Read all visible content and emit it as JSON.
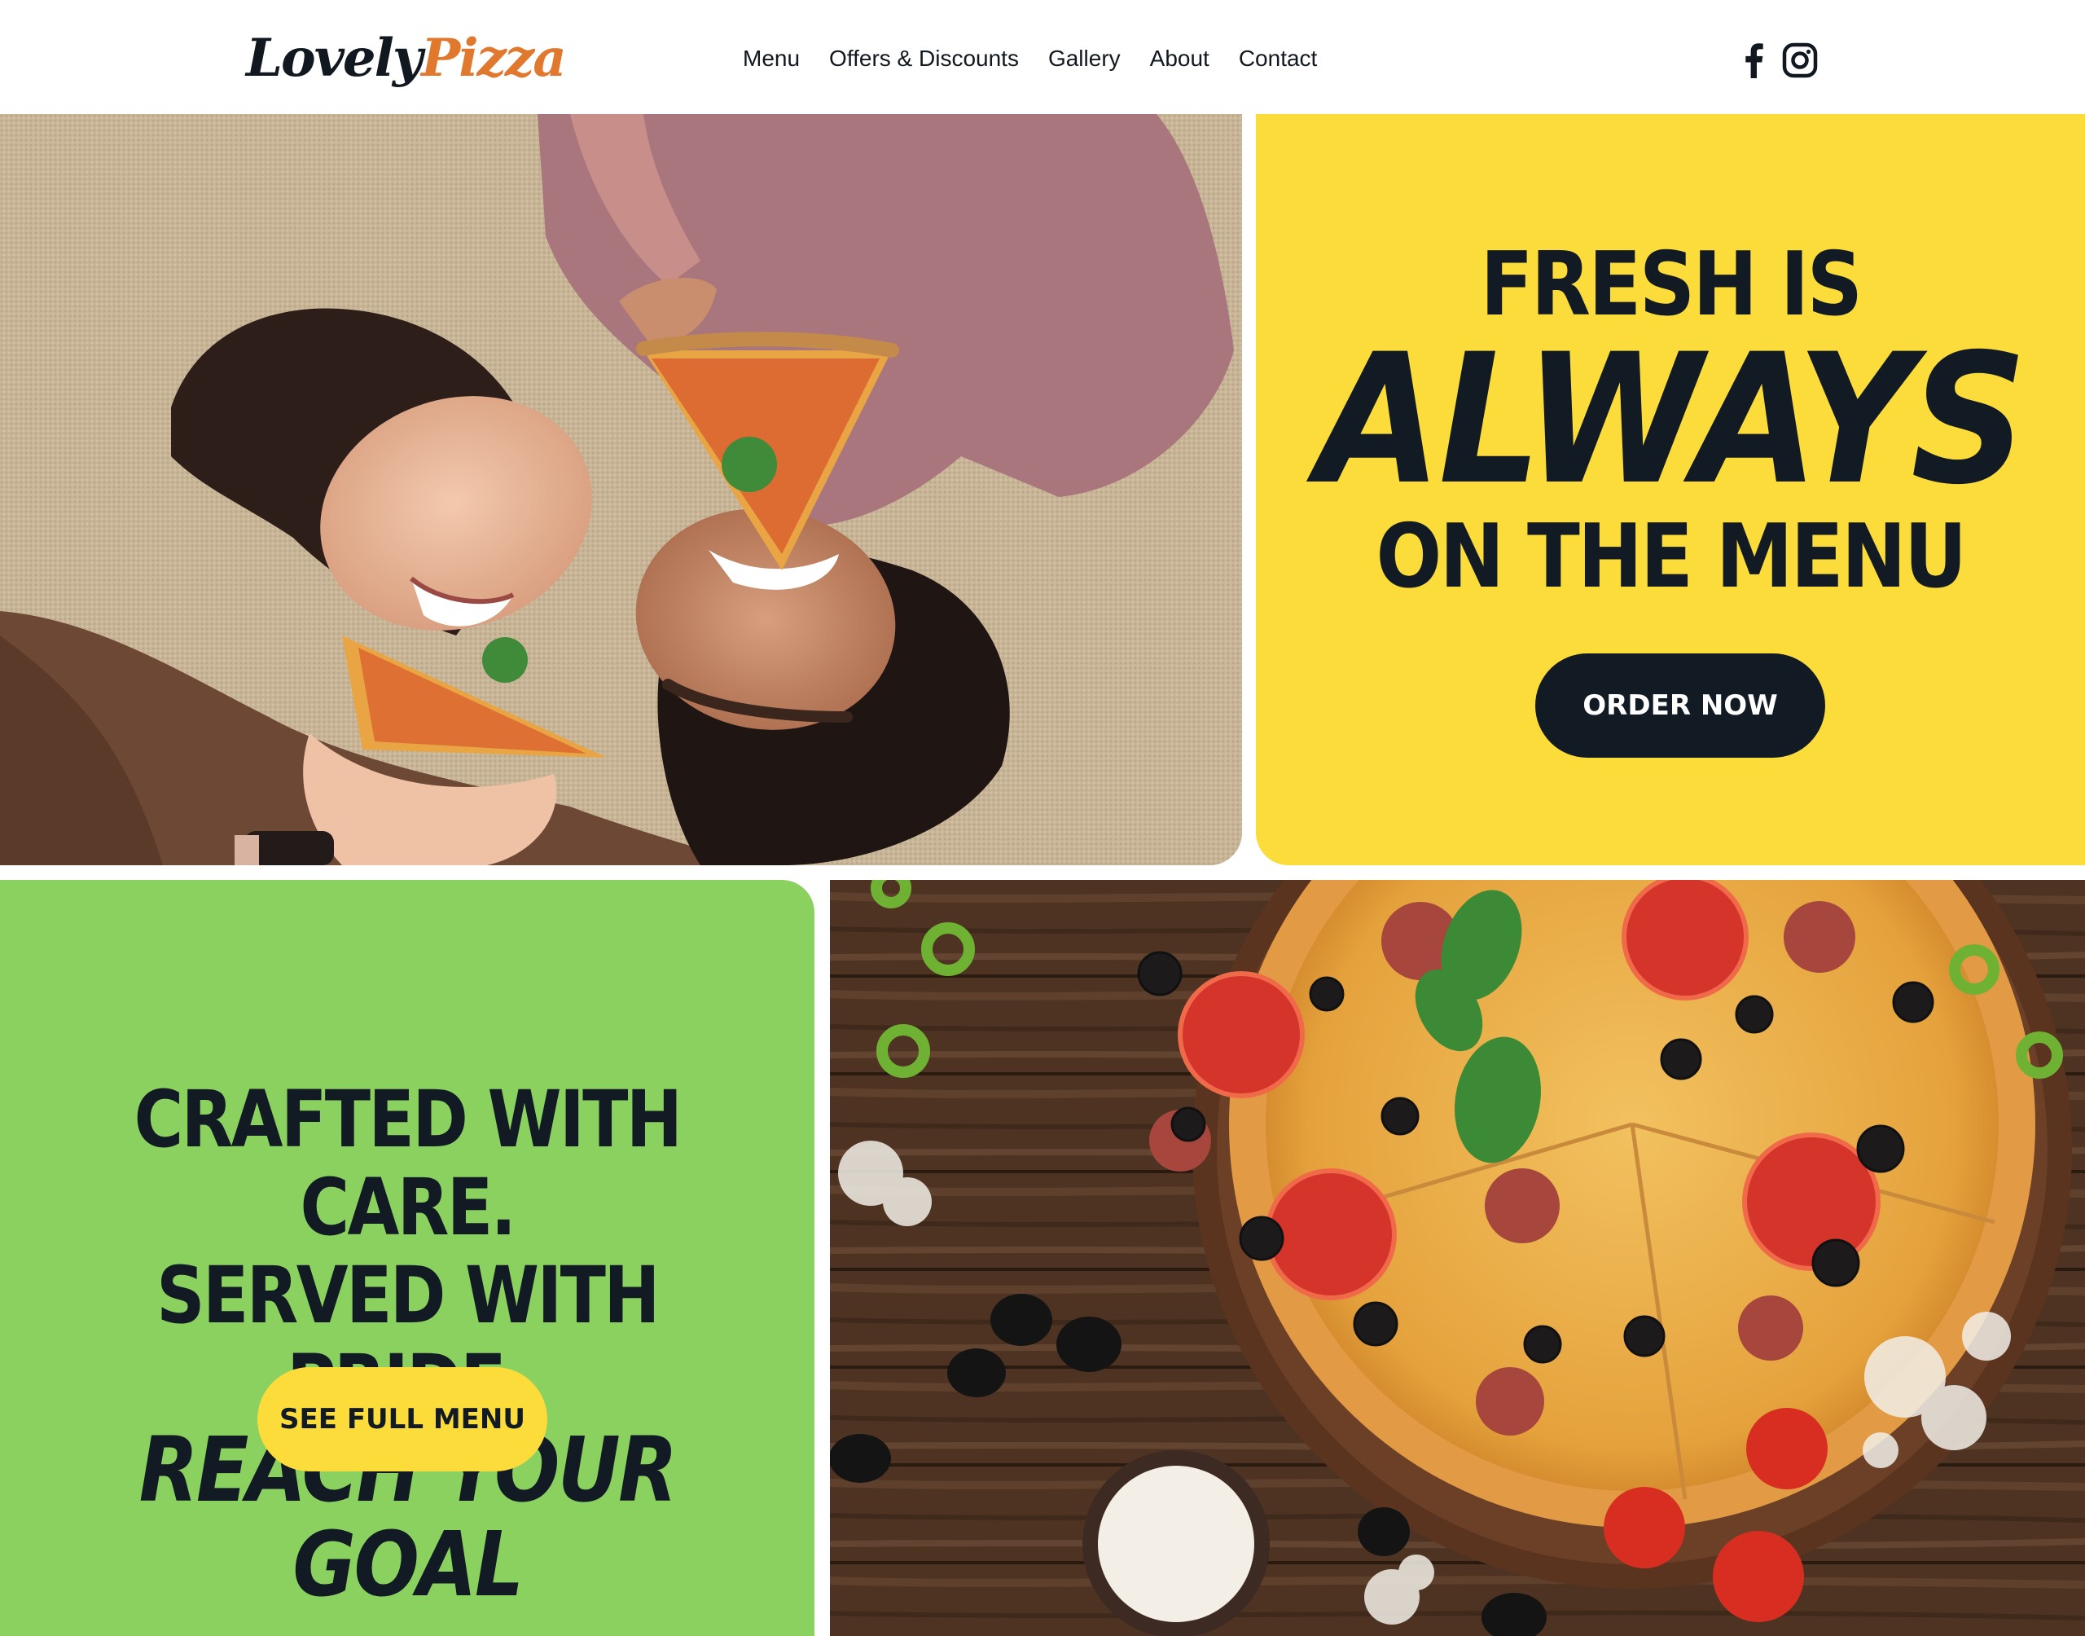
{
  "brand": {
    "part1": "Lovely",
    "part2": "Pizza",
    "accent": "#e0782e",
    "dark": "#111820"
  },
  "nav": {
    "items": [
      "Menu",
      "Offers & Discounts",
      "Gallery",
      "About",
      "Contact"
    ]
  },
  "social": {
    "icons": [
      "facebook-icon",
      "instagram-icon"
    ]
  },
  "hero": {
    "line1": "FRESH IS",
    "line2": "ALWAYS",
    "line3": "ON THE MENU",
    "cta": "ORDER NOW",
    "bg": "#fbdc3b"
  },
  "promo": {
    "line1": "CRAFTED WITH CARE.",
    "line2": "SERVED WITH PRIDE.",
    "line3": "REACH YOUR GOAL",
    "cta": "SEE FULL MENU",
    "bg": "#8bd160"
  },
  "images": {
    "photo1": "two women lying on carpet eating pizza slices",
    "photo2": "top view of pepperoni pizza on wooden table"
  }
}
